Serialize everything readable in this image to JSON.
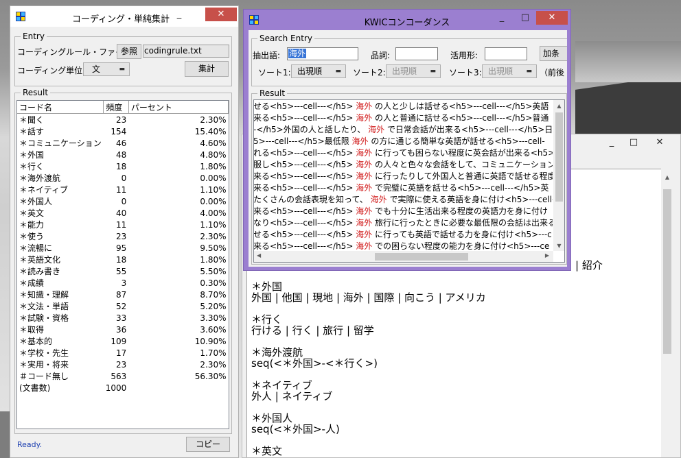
{
  "coding_window": {
    "title": "コーディング・単純集計",
    "minimize": "_",
    "close": "✕",
    "entry_legend": "Entry",
    "rule_file_label": "コーディングルール・ファイル:",
    "browse_button": "参照",
    "rule_file_value": "codingrule.txt",
    "unit_label": "コーディング単位:",
    "unit_value": "文",
    "tally_button": "集計",
    "result_legend": "Result",
    "columns": [
      "コード名",
      "頻度",
      "パーセント"
    ],
    "rows": [
      [
        "＊聞く",
        "23",
        "2.30%"
      ],
      [
        "＊話す",
        "154",
        "15.40%"
      ],
      [
        "＊コミュニケーション",
        "46",
        "4.60%"
      ],
      [
        "＊外国",
        "48",
        "4.80%"
      ],
      [
        "＊行く",
        "18",
        "1.80%"
      ],
      [
        "＊海外渡航",
        "0",
        "0.00%"
      ],
      [
        "＊ネイティブ",
        "11",
        "1.10%"
      ],
      [
        "＊外国人",
        "0",
        "0.00%"
      ],
      [
        "＊英文",
        "40",
        "4.00%"
      ],
      [
        "＊能力",
        "11",
        "1.10%"
      ],
      [
        "＊使う",
        "23",
        "2.30%"
      ],
      [
        "＊流暢に",
        "95",
        "9.50%"
      ],
      [
        "＊英語文化",
        "18",
        "1.80%"
      ],
      [
        "＊読み書き",
        "55",
        "5.50%"
      ],
      [
        "＊成績",
        "3",
        "0.30%"
      ],
      [
        "＊知識・理解",
        "87",
        "8.70%"
      ],
      [
        "＊文法・単語",
        "52",
        "5.20%"
      ],
      [
        "＊試験・資格",
        "33",
        "3.30%"
      ],
      [
        "＊取得",
        "36",
        "3.60%"
      ],
      [
        "＊基本的",
        "109",
        "10.90%"
      ],
      [
        "＊学校・先生",
        "17",
        "1.70%"
      ],
      [
        "＊実用・将来",
        "23",
        "2.30%"
      ],
      [
        "＃コード無し",
        "563",
        "56.30%"
      ],
      [
        "(文書数)",
        "1000",
        ""
      ]
    ],
    "status": "Ready.",
    "copy_button": "コピー"
  },
  "kwic_window": {
    "title": "KWICコンコーダンス",
    "minimize": "_",
    "maximize": "□",
    "close": "✕",
    "search_legend": "Search Entry",
    "word_label": "抽出語:",
    "word_value": "海外",
    "pos_label": "品詞:",
    "pos_value": "",
    "conj_label": "活用形:",
    "conj_value": "",
    "add_button": "加条",
    "sort1_label": "ソート1:",
    "sort1_value": "出現順",
    "sort2_label": "ソート2:",
    "sort2_value": "出現順",
    "sort3_label": "ソート3:",
    "sort3_value": "出現順",
    "context_label": "（前後",
    "result_legend": "Result",
    "lines": [
      {
        "left": "せる<h5>---cell---</h5> ",
        "kw": "海外",
        "right": " の人と少しは話せる<h5>---cell---</h5>英語"
      },
      {
        "left": "来る<h5>---cell---</h5> ",
        "kw": "海外",
        "right": " の人と普通に話せる<h5>---cell---</h5>普通"
      },
      {
        "left": "-</h5>外国の人と話したり、 ",
        "kw": "海外",
        "right": " で日常会話が出来る<h5>---cell---</h5>日"
      },
      {
        "left": "5>---cell---</h5>最低限 ",
        "kw": "海外",
        "right": " の方に通じる簡単な英語が話せる<h5>---cell-"
      },
      {
        "left": "れる<h5>---cell---</h5> ",
        "kw": "海外",
        "right": " に行っても困らない程度に英会話が出来る<h5>-"
      },
      {
        "left": "服し<h5>---cell---</h5> ",
        "kw": "海外",
        "right": " の人々と色々な会話をして、コミュニケーションを取"
      },
      {
        "left": "来る<h5>---cell---</h5> ",
        "kw": "海外",
        "right": " に行ったりして外国人と普通に英語で話せる程度に英語"
      },
      {
        "left": "来る<h5>---cell---</h5> ",
        "kw": "海外",
        "right": " で完璧に英語を話せる<h5>---cell---</h5>英"
      },
      {
        "left": "たくさんの会話表現を知って、 ",
        "kw": "海外",
        "right": " で実際に使える英語を身に付け<h5>---cell-"
      },
      {
        "left": "来る<h5>---cell---</h5> ",
        "kw": "海外",
        "right": " でも十分に生活出来る程度の英語力を身に付け"
      },
      {
        "left": "なり<h5>---cell---</h5> ",
        "kw": "海外",
        "right": " 旅行に行ったときに必要な最低限の会話は出来る"
      },
      {
        "left": "せる<h5>---cell---</h5> ",
        "kw": "海外",
        "right": " に行っても英語で話せる力を身に付け<h5>---c"
      },
      {
        "left": "来る<h5>---cell---</h5> ",
        "kw": "海外",
        "right": " での困らない程度の能力を身に付け<h5>---ce"
      }
    ]
  },
  "editor_window": {
    "minimize": "_",
    "maximize": "□",
    "close": "✕",
    "partial_line": "| 紹介",
    "lines": [
      "＊外国",
      "外国 | 他国 | 現地 | 海外 | 国際 | 向こう | アメリカ",
      "",
      "＊行く",
      "行ける | 行く | 旅行 | 留学",
      "",
      "＊海外渡航",
      "seq(<＊外国>-<＊行く>)",
      "",
      "＊ネイティブ",
      "外人 | ネイティブ",
      "",
      "＊外国人",
      "seq(<＊外国>-人)",
      "",
      "＊英文"
    ]
  }
}
